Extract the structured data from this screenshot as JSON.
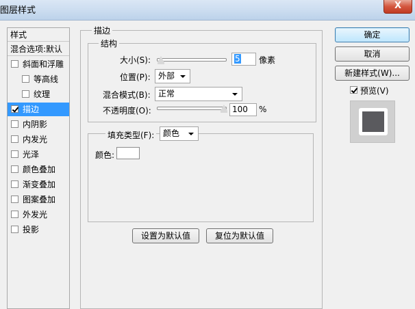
{
  "window": {
    "title": "图层样式",
    "close_glyph": "X"
  },
  "sidebar": {
    "header": "样式",
    "blend_options": "混合选项:默认",
    "items": [
      {
        "label": "斜面和浮雕",
        "checked": false,
        "indent": false
      },
      {
        "label": "等高线",
        "checked": false,
        "indent": true
      },
      {
        "label": "纹理",
        "checked": false,
        "indent": true
      },
      {
        "label": "描边",
        "checked": true,
        "indent": false,
        "selected": true
      },
      {
        "label": "内阴影",
        "checked": false,
        "indent": false
      },
      {
        "label": "内发光",
        "checked": false,
        "indent": false
      },
      {
        "label": "光泽",
        "checked": false,
        "indent": false
      },
      {
        "label": "颜色叠加",
        "checked": false,
        "indent": false
      },
      {
        "label": "渐变叠加",
        "checked": false,
        "indent": false
      },
      {
        "label": "图案叠加",
        "checked": false,
        "indent": false
      },
      {
        "label": "外发光",
        "checked": false,
        "indent": false
      },
      {
        "label": "投影",
        "checked": false,
        "indent": false
      }
    ]
  },
  "stroke": {
    "section_title": "描边",
    "structure_title": "结构",
    "size_label": "大小(S):",
    "size_value": "5",
    "size_unit": "像素",
    "size_slider_fraction": 0.02,
    "position_label": "位置(P):",
    "position_value": "外部",
    "blend_mode_label": "混合模式(B):",
    "blend_mode_value": "正常",
    "opacity_label": "不透明度(O):",
    "opacity_value": "100",
    "opacity_unit": "%",
    "opacity_slider_fraction": 1.0,
    "fill_type_label": "填充类型(F):",
    "fill_type_value": "颜色",
    "color_label": "颜色:",
    "color_value": "#ffffff"
  },
  "buttons": {
    "set_default": "设置为默认值",
    "reset_default": "复位为默认值",
    "ok": "确定",
    "cancel": "取消",
    "new_style": "新建样式(W)...",
    "preview_label": "预览(V)",
    "preview_checked": true
  },
  "preview_swatch": {
    "fill": "#5a5a5e",
    "stroke": "#ffffff"
  }
}
